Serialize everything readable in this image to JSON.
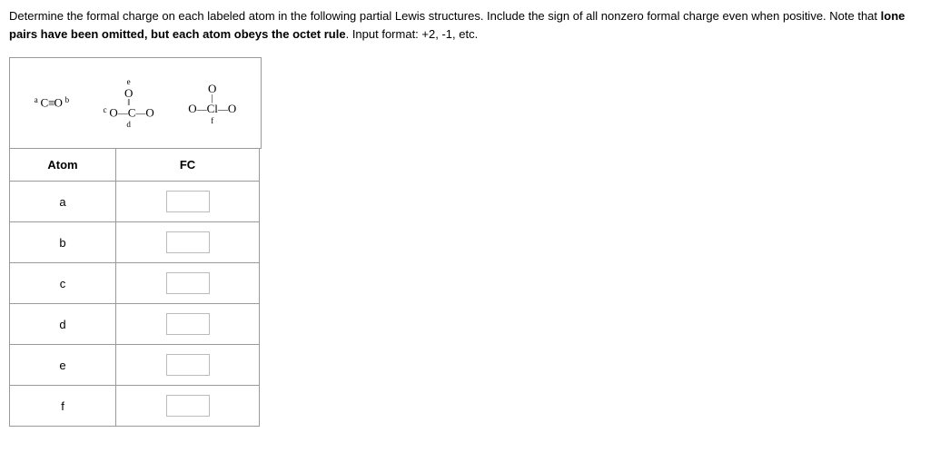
{
  "question": {
    "line1_pre": "Determine the formal charge on each labeled atom in the following partial Lewis structures. Include the sign of all nonzero formal charge even when positive. Note that ",
    "bold": "lone pairs have been omitted, but each atom obeys the octet rule",
    "line1_post": ". Input format: +2, -1, etc."
  },
  "structures": {
    "s1": {
      "a_label": "a",
      "b_label": "b",
      "formula_left": "C",
      "bond": "≡",
      "formula_right": "O"
    },
    "s2": {
      "c_label": "c",
      "d_label": "d",
      "e_label": "e",
      "top": "O",
      "center": "C",
      "left": "O",
      "right": "O"
    },
    "s3": {
      "f_label": "f",
      "top": "O",
      "center": "Cl",
      "left": "O",
      "right": "O"
    }
  },
  "table": {
    "header_atom": "Atom",
    "header_fc": "FC",
    "rows": [
      {
        "atom": "a",
        "value": ""
      },
      {
        "atom": "b",
        "value": ""
      },
      {
        "atom": "c",
        "value": ""
      },
      {
        "atom": "d",
        "value": ""
      },
      {
        "atom": "e",
        "value": ""
      },
      {
        "atom": "f",
        "value": ""
      }
    ]
  }
}
